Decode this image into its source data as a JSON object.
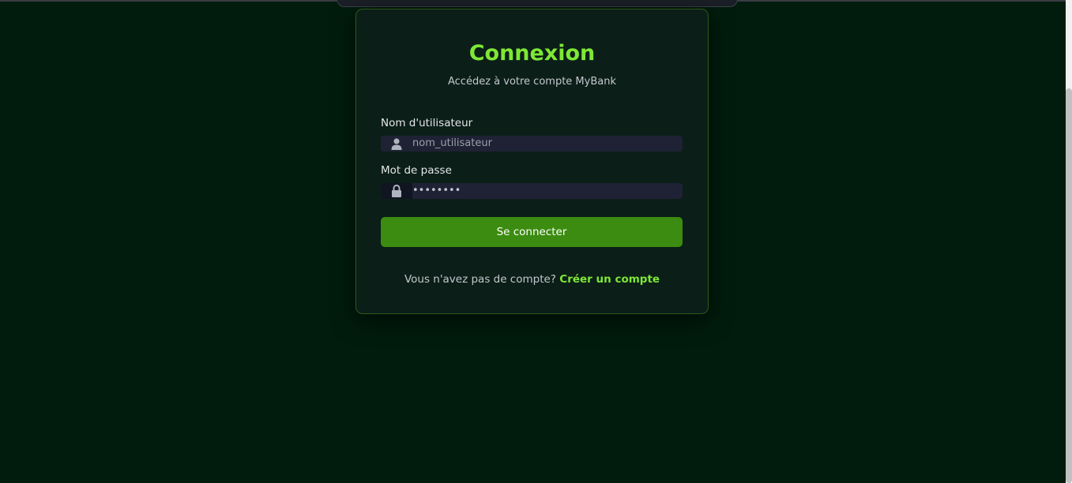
{
  "login": {
    "title": "Connexion",
    "subtitle": "Accédez à votre compte MyBank",
    "username_label": "Nom d'utilisateur",
    "username_placeholder": "nom_utilisateur",
    "username_icon": "user-icon",
    "password_label": "Mot de passe",
    "password_value": "••••••••",
    "password_icon": "lock-icon",
    "submit_label": "Se connecter",
    "footer_text": "Vous n'avez pas de compte?",
    "register_link": "Créer un compte"
  },
  "colors": {
    "background": "#011c0d",
    "card": "#0b1e18",
    "accent": "#7ee835",
    "button": "#3b8c10",
    "input": "#1e2234"
  }
}
